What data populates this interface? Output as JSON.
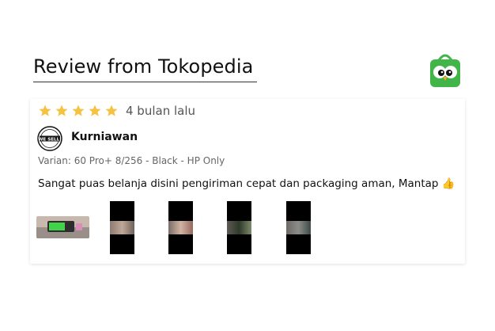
{
  "header": {
    "title": "Review from Tokopedia",
    "logo_icon": "tokopedia-owl-icon"
  },
  "review": {
    "rating": 5,
    "max_rating": 5,
    "time_ago": "4 bulan lalu",
    "avatar_text": "WE SELL!",
    "username": "Kurniawan",
    "variant": "Varian: 60 Pro+ 8/256 - Black - HP Only",
    "text": "Sangat puas belanja disini pengiriman cepat dan packaging aman, Mantap 👍",
    "photos_count": 5
  },
  "colors": {
    "star": "#f5c241",
    "brand_green": "#42b549",
    "text_primary": "#111111",
    "text_secondary": "#666666"
  }
}
